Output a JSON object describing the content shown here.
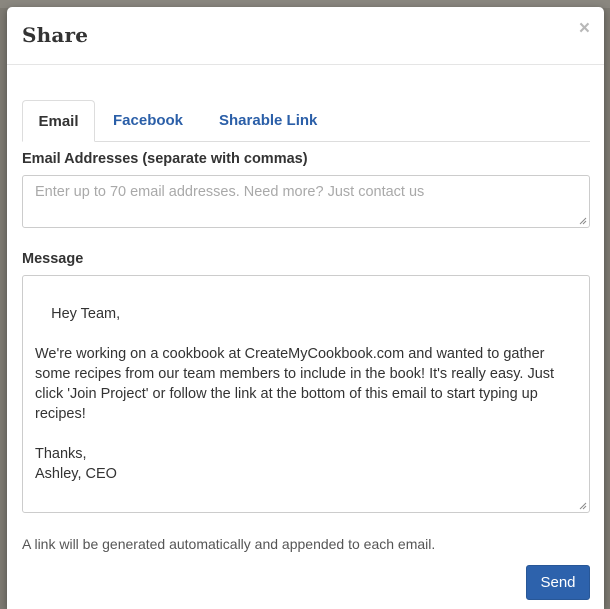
{
  "dialog": {
    "title": "Share",
    "close_glyph": "×"
  },
  "tabs": [
    {
      "label": "Email",
      "active": true
    },
    {
      "label": "Facebook",
      "active": false
    },
    {
      "label": "Sharable Link",
      "active": false
    }
  ],
  "email": {
    "label": "Email Addresses (separate with commas)",
    "value": "",
    "placeholder": "Enter up to 70 email addresses. Need more? Just contact us"
  },
  "message": {
    "label": "Message",
    "value": "Hey Team,\n\nWe're working on a cookbook at CreateMyCookbook.com and wanted to gather some recipes from our team members to include in the book! It's really easy. Just click 'Join Project' or follow the link at the bottom of this email to start typing up recipes!\n\nThanks,\nAshley, CEO"
  },
  "note": "A link will be generated automatically and appended to each email.",
  "send_label": "Send",
  "colors": {
    "accent": "#2d62ac",
    "link": "#2b5fa8"
  },
  "icons": {
    "close": "close-icon",
    "resize": "resize-grip-icon"
  }
}
